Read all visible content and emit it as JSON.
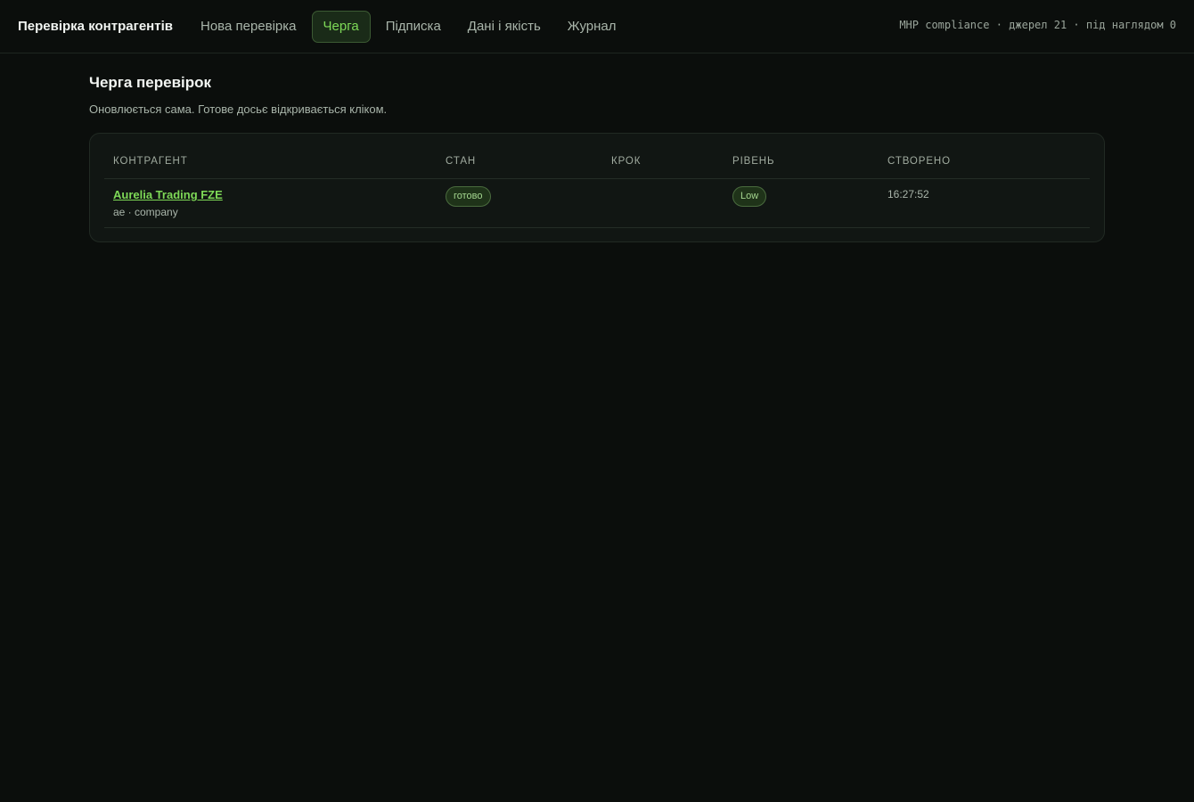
{
  "header": {
    "brand": "Перевірка контрагентів",
    "nav": [
      {
        "label": "Нова перевірка",
        "active": false
      },
      {
        "label": "Черга",
        "active": true
      },
      {
        "label": "Підписка",
        "active": false
      },
      {
        "label": "Дані і якість",
        "active": false
      },
      {
        "label": "Журнал",
        "active": false
      }
    ],
    "status": "MHP compliance · джерел 21 · під наглядом 0"
  },
  "main": {
    "title": "Черга перевірок",
    "subtitle": "Оновлюється сама. Готове досьє відкривається кліком.",
    "table": {
      "columns": [
        "Контрагент",
        "Стан",
        "Крок",
        "Рівень",
        "Створено"
      ],
      "rows": [
        {
          "name": "Aurelia Trading FZE",
          "meta": "ae · company",
          "state": "готово",
          "step": "",
          "level": "Low",
          "created": "16:27:52"
        }
      ]
    }
  },
  "colors": {
    "accent": "#7ed957",
    "background": "#0b0e0c",
    "card": "#111613"
  }
}
